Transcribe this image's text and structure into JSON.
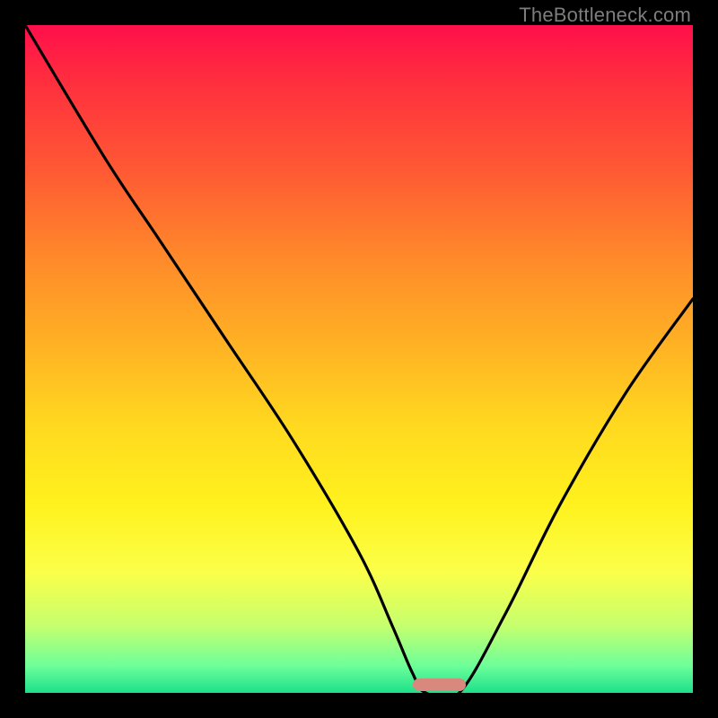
{
  "attribution": "TheBottleneck.com",
  "chart_data": {
    "type": "line",
    "title": "",
    "xlabel": "",
    "ylabel": "",
    "xlim": [
      0,
      100
    ],
    "ylim": [
      0,
      100
    ],
    "series": [
      {
        "name": "bottleneck-curve",
        "x": [
          0,
          12,
          20,
          30,
          40,
          50,
          55,
          58,
          60,
          65,
          72,
          80,
          90,
          100
        ],
        "values": [
          100,
          80,
          68,
          53,
          38,
          21,
          10,
          3,
          0,
          0,
          12,
          28,
          45,
          59
        ]
      }
    ],
    "trough_marker": {
      "x_start": 58,
      "x_end": 66,
      "color": "#d9887e"
    },
    "background_gradient": {
      "stops": [
        {
          "pct": 0,
          "color": "#ff0f4b"
        },
        {
          "pct": 22,
          "color": "#ff5a33"
        },
        {
          "pct": 48,
          "color": "#ffb224"
        },
        {
          "pct": 72,
          "color": "#fff21e"
        },
        {
          "pct": 90,
          "color": "#c5ff6e"
        },
        {
          "pct": 100,
          "color": "#1ce08a"
        }
      ]
    }
  }
}
